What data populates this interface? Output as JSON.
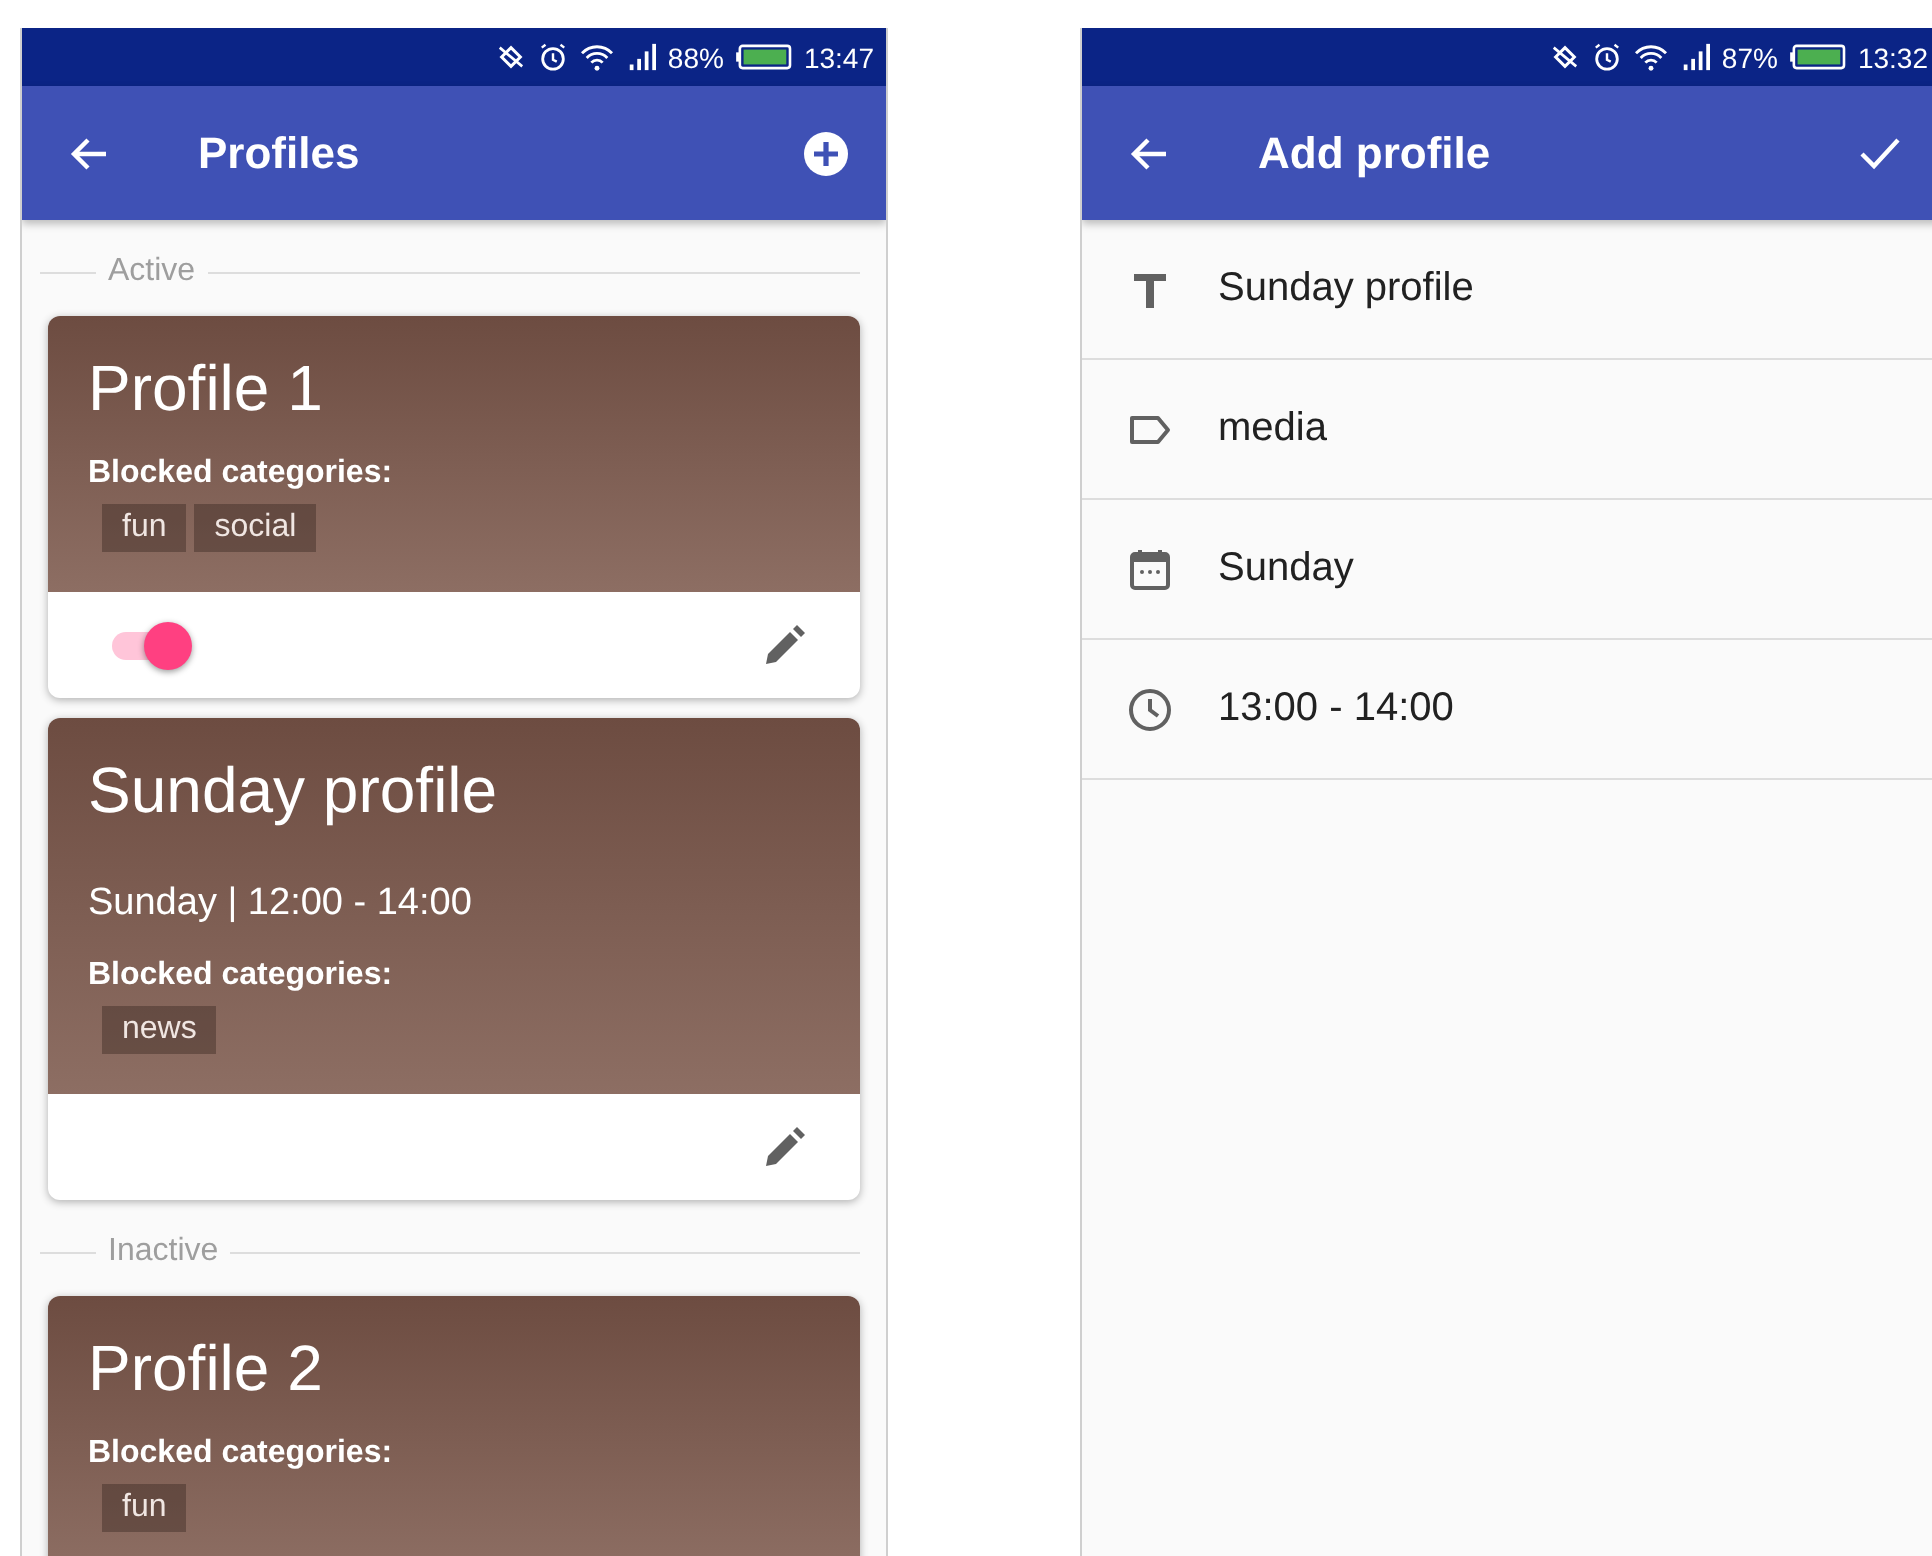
{
  "screens": [
    {
      "status_bar": {
        "battery": "88%",
        "time": "13:47"
      },
      "app_bar": {
        "title": "Profiles",
        "kind": "list"
      },
      "sections": [
        {
          "label": "Active",
          "profiles": [
            {
              "name": "Profile 1",
              "blocked_label": "Blocked categories:",
              "categories": [
                "fun",
                "social"
              ],
              "toggle": {
                "on": true
              },
              "editable": true
            },
            {
              "name": "Sunday profile",
              "schedule": "Sunday | 12:00 - 14:00",
              "blocked_label": "Blocked categories:",
              "categories": [
                "news"
              ],
              "editable": true
            }
          ]
        },
        {
          "label": "Inactive",
          "profiles": [
            {
              "name": "Profile 2",
              "blocked_label": "Blocked categories:",
              "categories": [
                "fun"
              ]
            }
          ]
        }
      ]
    },
    {
      "status_bar": {
        "battery": "87%",
        "time": "13:32"
      },
      "app_bar": {
        "title": "Add profile",
        "kind": "form"
      },
      "fields": [
        {
          "kind": "title",
          "value": "Sunday profile"
        },
        {
          "kind": "tag",
          "value": "media"
        },
        {
          "kind": "day",
          "value": "Sunday"
        },
        {
          "kind": "time",
          "value": "13:00 - 14:00"
        }
      ]
    }
  ]
}
